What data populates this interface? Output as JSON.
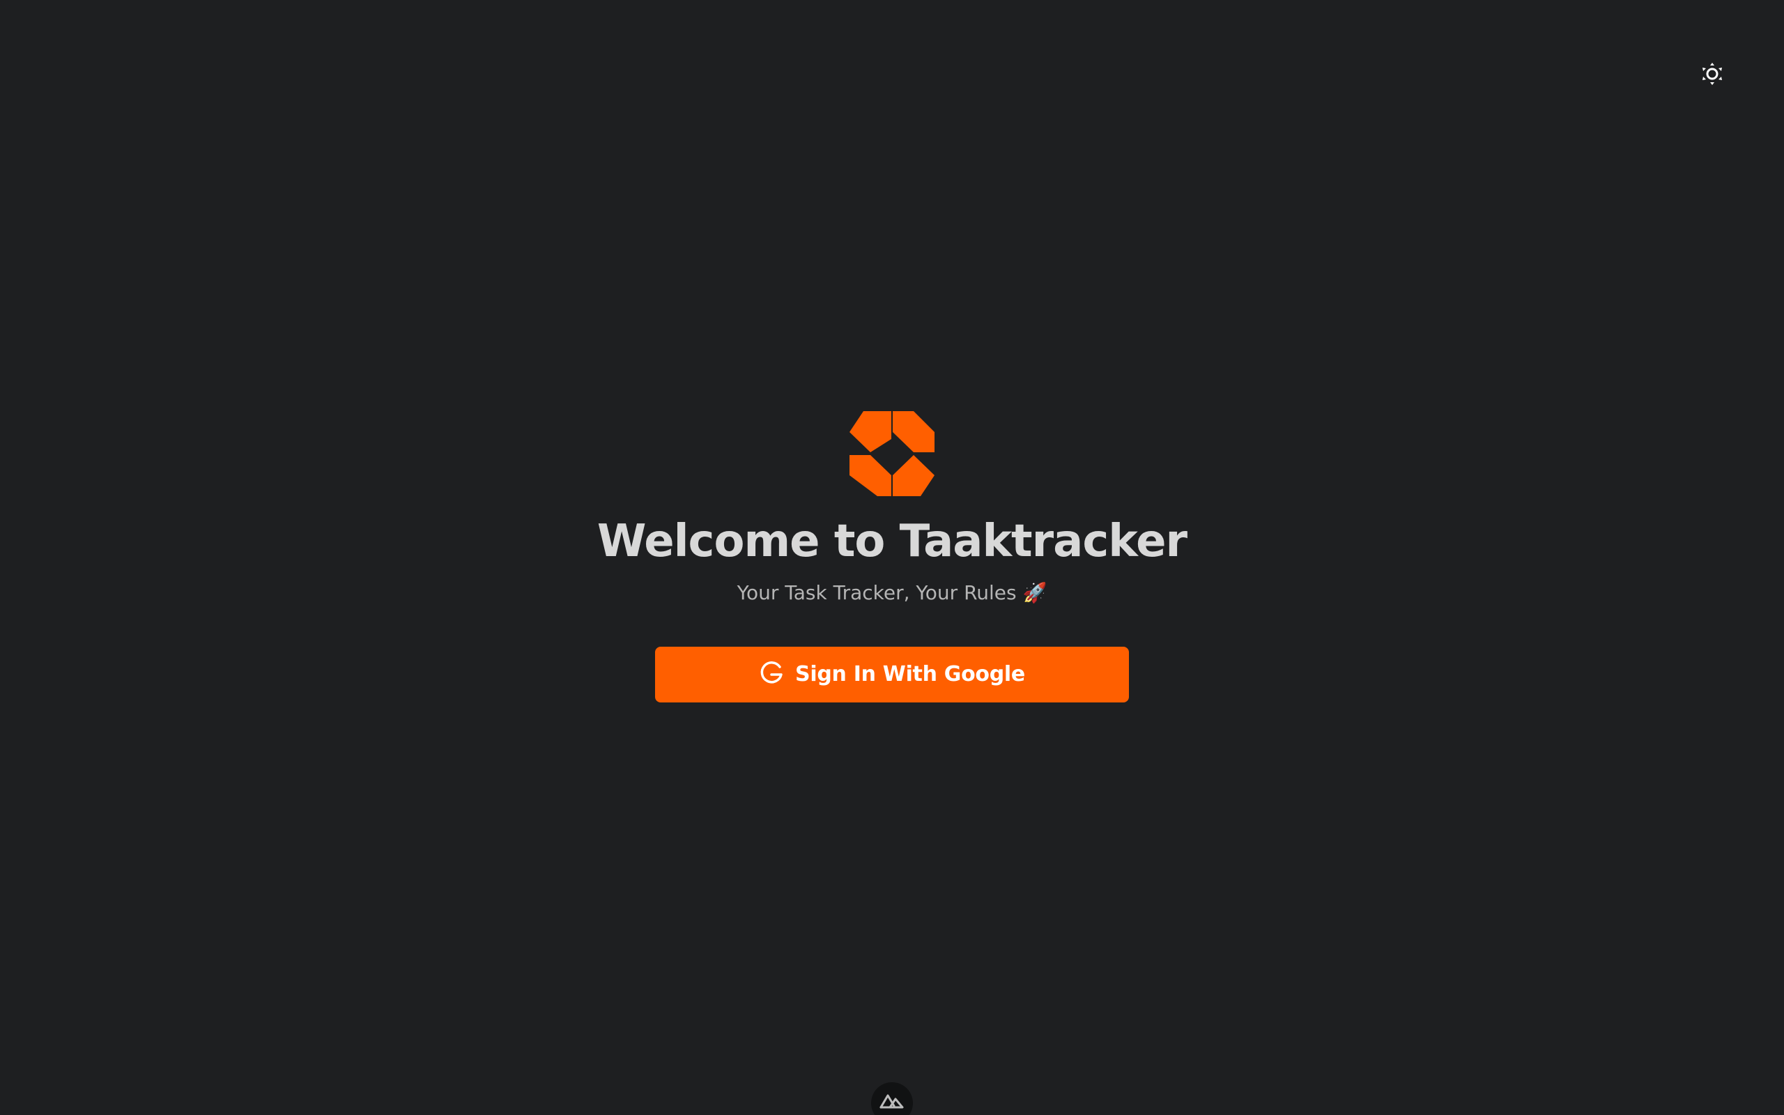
{
  "header": {
    "theme_toggle_icon": "sun-icon"
  },
  "hero": {
    "logo_icon": "taaktracker-logo-icon",
    "title": "Welcome to Taaktracker",
    "subtitle": "Your Task Tracker, Your Rules 🚀"
  },
  "auth": {
    "google_button_label": "Sign In With Google",
    "google_icon": "google-icon"
  },
  "footer": {
    "badge_icon": "nuxt-icon"
  },
  "colors": {
    "background": "#1e1f21",
    "accent": "#ff5f00",
    "title_text": "#d8d8d8",
    "subtitle_text": "#b5b5b5"
  }
}
